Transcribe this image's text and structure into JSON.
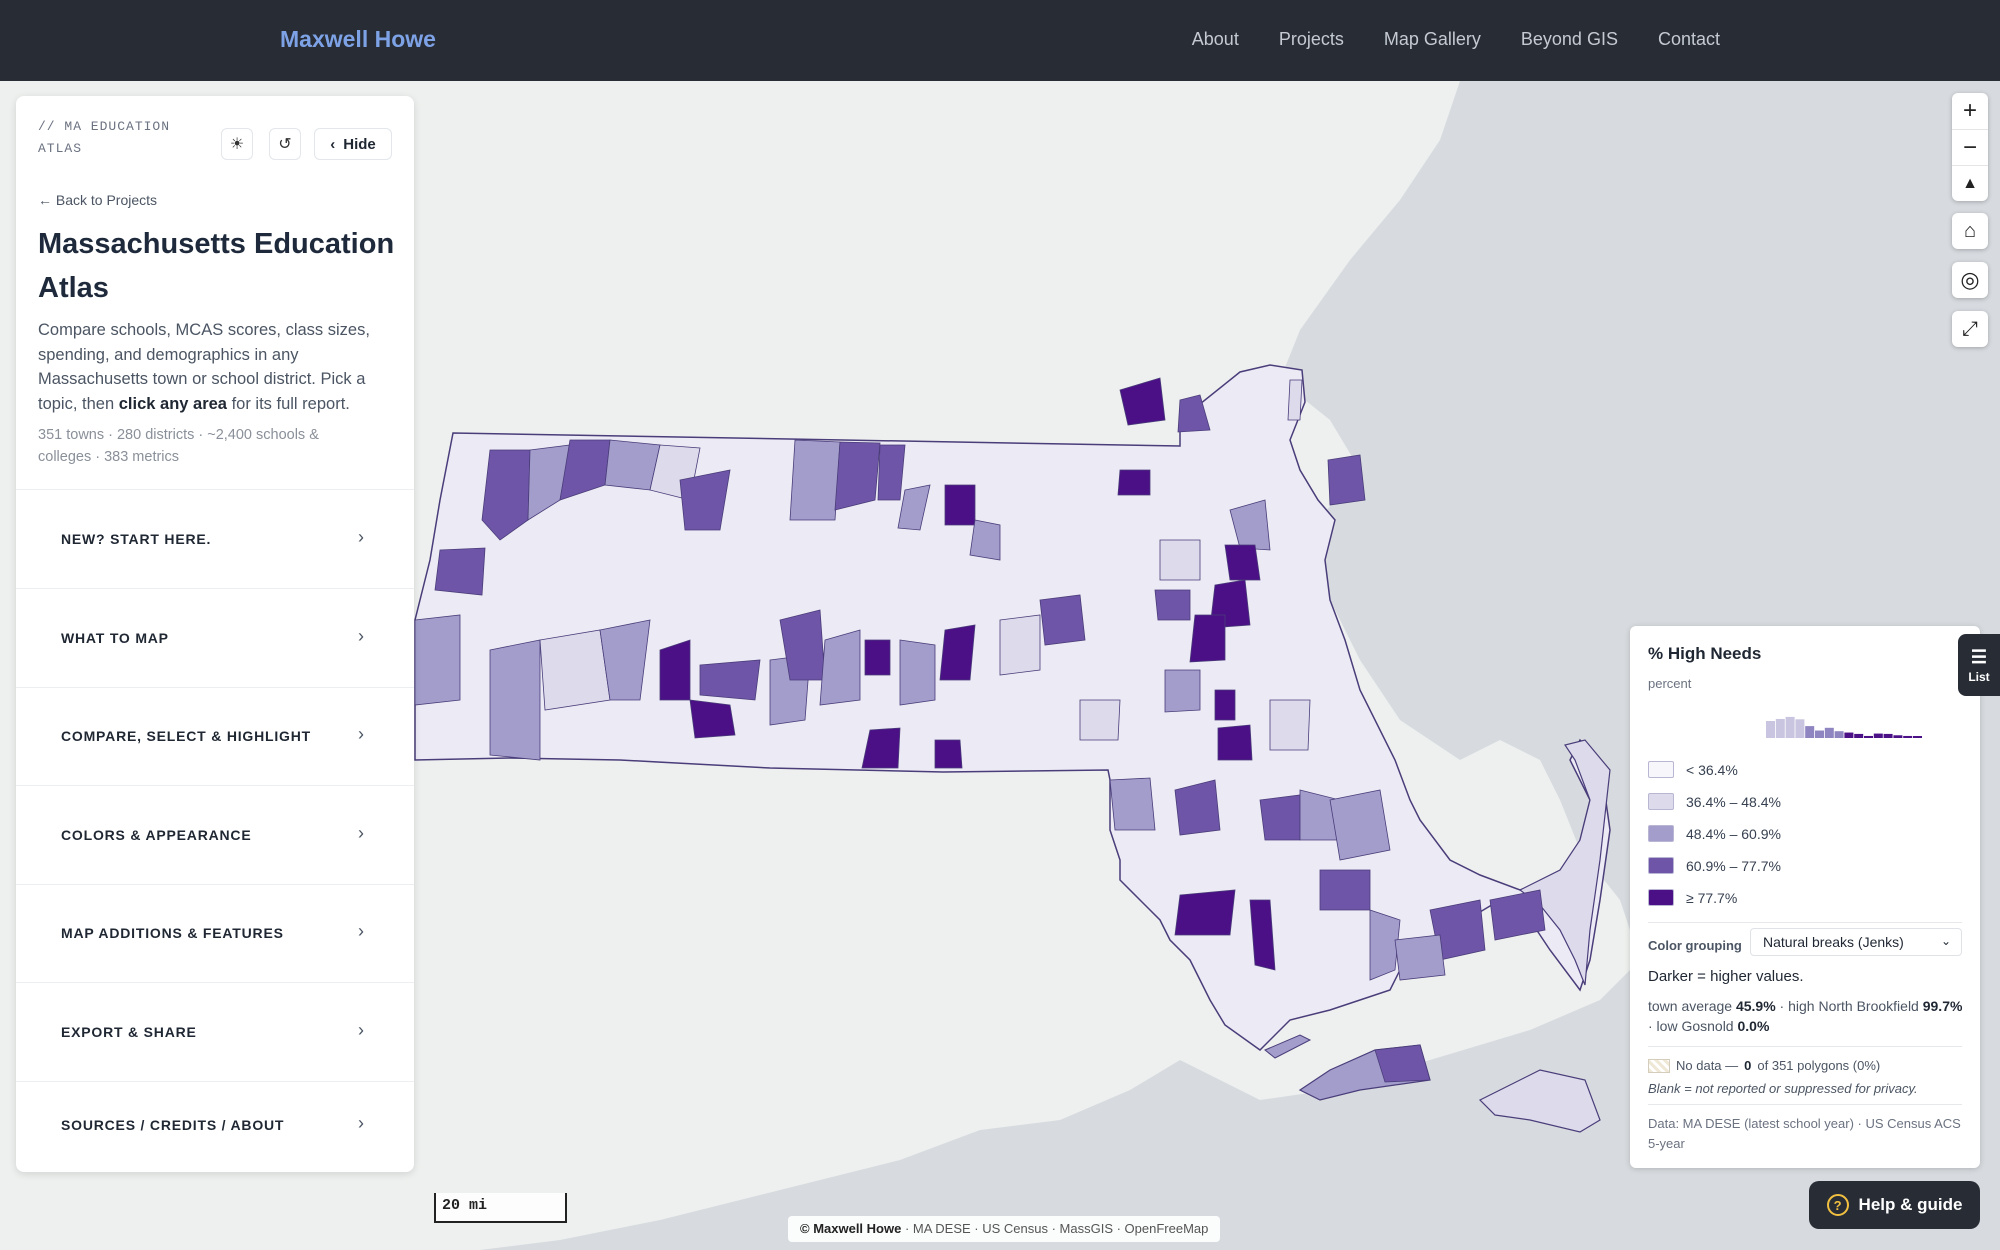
{
  "header": {
    "brand": "Maxwell Howe",
    "nav": [
      "About",
      "Projects",
      "Map Gallery",
      "Beyond GIS",
      "Contact"
    ]
  },
  "panel": {
    "kicker": "// MA EDUCATION ATLAS",
    "hide_label": "Hide",
    "back_link": "← Back to Projects",
    "title": "Massachusetts Education Atlas",
    "description_pre": "Compare schools, MCAS scores, class sizes, spending, and demographics in any Massachusetts town or school district. Pick a topic, then ",
    "description_bold": "click any area",
    "description_post": " for its full report.",
    "stats": "351 towns · 280 districts · ~2,400 schools & colleges · 383 metrics",
    "sections": [
      "NEW? START HERE.",
      "WHAT TO MAP",
      "COMPARE, SELECT & HIGHLIGHT",
      "COLORS & APPEARANCE",
      "MAP ADDITIONS & FEATURES",
      "EXPORT & SHARE",
      "SOURCES / CREDITS / ABOUT"
    ]
  },
  "legend": {
    "title": "% High Needs",
    "unit": "percent",
    "classes": [
      {
        "label": "< 36.4%",
        "color": "#f7f6fb"
      },
      {
        "label": "36.4% – 48.4%",
        "color": "#dcdaeb"
      },
      {
        "label": "48.4% – 60.9%",
        "color": "#a29dcb"
      },
      {
        "label": "60.9% – 77.7%",
        "color": "#6f55a8"
      },
      {
        "label": "≥ 77.7%",
        "color": "#4b0f86"
      }
    ],
    "histogram": [
      0.5,
      0.56,
      0.62,
      0.55,
      0.35,
      0.22,
      0.3,
      0.2,
      0.16,
      0.12,
      0.06,
      0.13,
      0.12,
      0.08,
      0.06,
      0.05
    ],
    "grouping_label": "Color grouping",
    "grouping_value": "Natural breaks (Jenks)",
    "darker_note": "Darker = higher values.",
    "avg_pre": "town average ",
    "avg_value": "45.9%",
    "high_pre": " · high North Brookfield ",
    "high_value": "99.7%",
    "low_pre": " · low Gosnold ",
    "low_value": "0.0%",
    "nodata_pre": "No data — ",
    "nodata_count": "0",
    "nodata_post": " of 351 polygons (0%)",
    "blank_note": "Blank = not reported or suppressed for privacy.",
    "source": "Data: MA DESE (latest school year) · US Census ACS 5-year"
  },
  "map": {
    "scale_label": "20 mi",
    "attribution_bold": "© Maxwell Howe",
    "attribution_rest": " · MA DESE · US Census · MassGIS · OpenFreeMap",
    "water_color": "#d7dbdf",
    "land_color": "#eef0ef"
  },
  "list_tab_label": "List",
  "help_label": "Help & guide"
}
